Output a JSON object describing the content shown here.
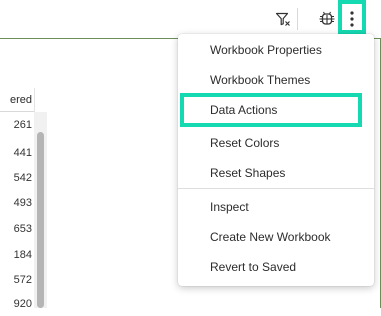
{
  "toolbar": {
    "filter_icon": "filter-icon",
    "bug_icon": "debug-icon",
    "more_icon": "kebab-menu-icon"
  },
  "table": {
    "header": "ered",
    "values": [
      "261",
      "441",
      "542",
      "493",
      "653",
      "184",
      "572",
      "920"
    ]
  },
  "menu": {
    "items": [
      {
        "label": "Workbook Properties"
      },
      {
        "label": "Workbook Themes"
      },
      {
        "label": "Data Actions"
      },
      {
        "label": "Reset Colors"
      },
      {
        "label": "Reset Shapes"
      },
      {
        "label": "Inspect"
      },
      {
        "label": "Create New Workbook"
      },
      {
        "label": "Revert to Saved"
      }
    ]
  },
  "colors": {
    "highlight": "#14d9b1",
    "canvas_border": "#6c8f5a"
  }
}
